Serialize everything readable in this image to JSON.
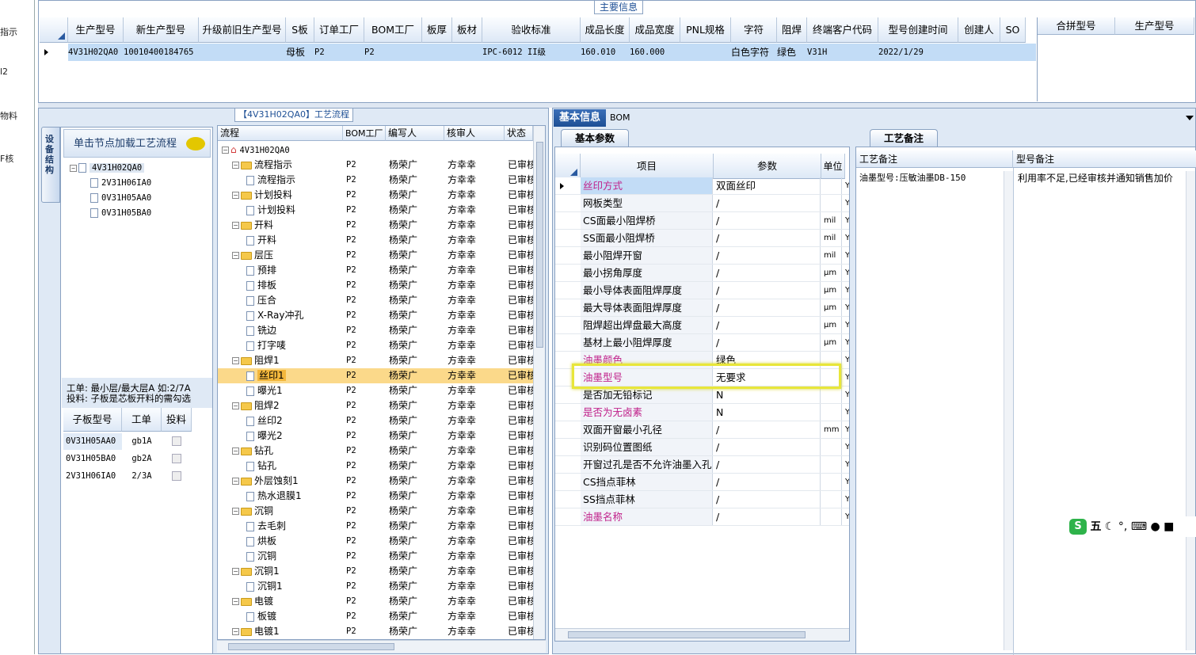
{
  "left_strip": [
    "指示",
    "l2",
    "物料",
    "F核"
  ],
  "top": {
    "title": "主要信息",
    "columns": [
      "生产型号",
      "新生产型号",
      "升级前旧生产型号",
      "S板",
      "订单工厂",
      "BOM工厂",
      "板厚",
      "板材",
      "验收标准",
      "成品长度",
      "成品宽度",
      "PNL规格",
      "字符",
      "阻焊",
      "终端客户代码",
      "型号创建时间",
      "创建人",
      "SO"
    ],
    "row": [
      "4V31H02QA0",
      "10010400184765",
      "",
      "母板",
      "P2",
      "P2",
      "",
      "",
      "IPC-6012 II级",
      "160.010",
      "160.000",
      "",
      "白色字符",
      "绿色",
      "V31H",
      "2022/1/29",
      "",
      ""
    ],
    "merge_columns": [
      "合拼型号",
      "生产型号"
    ]
  },
  "flow": {
    "title": "【4V31H02QA0】工艺流程",
    "vtab": "设备结构",
    "hint": "单击节点加载工艺流程",
    "mini_tree": [
      "4V31H02QA0",
      "2V31H06IA0",
      "0V31H05AA0",
      "0V31H05BA0"
    ],
    "info1": "工单: 最小层/最大层A 如:2/7A",
    "info2": "投料: 子板是芯板开料的需勾选",
    "sub_columns": [
      "子板型号",
      "工单",
      "投料"
    ],
    "sub_rows": [
      [
        "0V31H05AA0",
        "gb1A"
      ],
      [
        "0V31H05BA0",
        "gb2A"
      ],
      [
        "2V31H06IA0",
        "2/3A"
      ]
    ],
    "tree_columns": [
      "流程",
      "BOM工厂",
      "编写人",
      "核审人",
      "状态"
    ],
    "tree_root": "4V31H02QA0",
    "tree_rows": [
      {
        "t": "folder",
        "label": "流程指示"
      },
      {
        "t": "doc",
        "label": "流程指示"
      },
      {
        "t": "folder",
        "label": "计划投料"
      },
      {
        "t": "doc",
        "label": "计划投料"
      },
      {
        "t": "folder",
        "label": "开料"
      },
      {
        "t": "doc",
        "label": "开料"
      },
      {
        "t": "folder",
        "label": "层压"
      },
      {
        "t": "doc",
        "label": "预排"
      },
      {
        "t": "doc",
        "label": "排板"
      },
      {
        "t": "doc",
        "label": "压合"
      },
      {
        "t": "doc",
        "label": "X-Ray冲孔"
      },
      {
        "t": "doc",
        "label": "铣边"
      },
      {
        "t": "doc",
        "label": "打字唛"
      },
      {
        "t": "folder",
        "label": "阻焊1"
      },
      {
        "t": "doc",
        "label": "丝印1",
        "sel": true
      },
      {
        "t": "doc",
        "label": "曝光1"
      },
      {
        "t": "folder",
        "label": "阻焊2"
      },
      {
        "t": "doc",
        "label": "丝印2"
      },
      {
        "t": "doc",
        "label": "曝光2"
      },
      {
        "t": "folder",
        "label": "钻孔"
      },
      {
        "t": "doc",
        "label": "钻孔"
      },
      {
        "t": "folder",
        "label": "外层蚀刻1"
      },
      {
        "t": "doc",
        "label": "热水退膜1"
      },
      {
        "t": "folder",
        "label": "沉铜"
      },
      {
        "t": "doc",
        "label": "去毛刺"
      },
      {
        "t": "doc",
        "label": "烘板"
      },
      {
        "t": "doc",
        "label": "沉铜"
      },
      {
        "t": "folder",
        "label": "沉铜1"
      },
      {
        "t": "doc",
        "label": "沉铜1"
      },
      {
        "t": "folder",
        "label": "电镀"
      },
      {
        "t": "doc",
        "label": "板镀"
      },
      {
        "t": "folder",
        "label": "电镀1"
      }
    ],
    "row_factory": "P2",
    "row_writer": "杨荣广",
    "row_reviewer": "方幸幸",
    "row_status": "已审核"
  },
  "right": {
    "tab_basic": "基本信息",
    "tab_bom": "BOM",
    "params_tab": "基本参数",
    "params_columns": [
      "项目",
      "参数",
      "单位"
    ],
    "params": [
      {
        "item": "丝印方式",
        "value": "双面丝印",
        "unit": "",
        "pink": true
      },
      {
        "item": "网板类型",
        "value": "/",
        "unit": ""
      },
      {
        "item": "CS面最小阻焊桥",
        "value": "/",
        "unit": "mil"
      },
      {
        "item": "SS面最小阻焊桥",
        "value": "/",
        "unit": "mil"
      },
      {
        "item": "最小阻焊开窗",
        "value": "/",
        "unit": "mil"
      },
      {
        "item": "最小拐角厚度",
        "value": "/",
        "unit": "μm"
      },
      {
        "item": "最小导体表面阻焊厚度",
        "value": "/",
        "unit": "μm"
      },
      {
        "item": "最大导体表面阻焊厚度",
        "value": "/",
        "unit": "μm"
      },
      {
        "item": "阻焊超出焊盘最大高度",
        "value": "/",
        "unit": "μm"
      },
      {
        "item": "基材上最小阻焊厚度",
        "value": "/",
        "unit": "μm"
      },
      {
        "item": "油墨颜色",
        "value": "绿色",
        "unit": "",
        "pink": true
      },
      {
        "item": "油墨型号",
        "value": "无要求",
        "unit": "",
        "pink": true
      },
      {
        "item": "是否加无铅标记",
        "value": "N",
        "unit": ""
      },
      {
        "item": "是否为无卤素",
        "value": "N",
        "unit": "",
        "pink": true
      },
      {
        "item": "双面开窗最小孔径",
        "value": "/",
        "unit": "mm"
      },
      {
        "item": "识别码位置图纸",
        "value": "/",
        "unit": ""
      },
      {
        "item": "开窗过孔是否不允许油墨入孔",
        "value": "/",
        "unit": ""
      },
      {
        "item": "CS挡点菲林",
        "value": "/",
        "unit": ""
      },
      {
        "item": "SS挡点菲林",
        "value": "/",
        "unit": ""
      },
      {
        "item": "油墨名称",
        "value": "/",
        "unit": "",
        "pink": true
      }
    ],
    "flag": "Y",
    "process_tab": "工艺备注",
    "notes_columns": [
      "工艺备注",
      "型号备注"
    ],
    "note1": "油墨型号:压敏油墨DB-150",
    "note2": "利用率不足,已经审核并通知销售加价"
  },
  "ime": {
    "label": "五"
  }
}
